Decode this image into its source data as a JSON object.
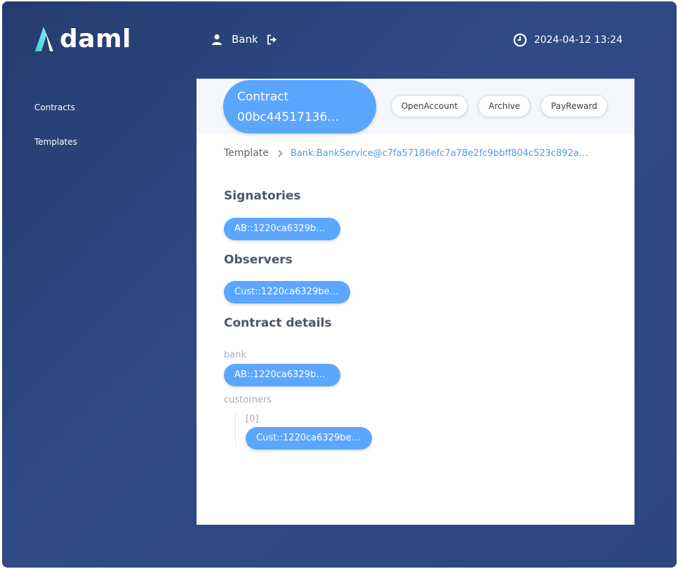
{
  "header": {
    "logo_text": "daml",
    "user_name": "Bank",
    "datetime": "2024-04-12 13:24",
    "icons": {
      "user": "person-icon",
      "logout": "logout-icon",
      "clock": "clock-icon"
    }
  },
  "sidebar": {
    "items": [
      {
        "label": "Contracts"
      },
      {
        "label": "Templates"
      }
    ]
  },
  "contract": {
    "pill_line1": "Contract",
    "pill_line2": "00bc44517136…",
    "choices": [
      "OpenAccount",
      "Archive",
      "PayReward"
    ],
    "breadcrumb": {
      "root": "Template",
      "template_id": "Bank:BankService@c7fa57186efc7a78e2fc9bbff804c523c892a…"
    },
    "signatories_title": "Signatories",
    "signatories": [
      "AB::1220ca6329be…"
    ],
    "observers_title": "Observers",
    "observers": [
      "Cust::1220ca6329be…"
    ],
    "details_title": "Contract details",
    "details": {
      "bank_label": "bank",
      "bank_value": "AB::1220ca6329be…",
      "customers_label": "customers",
      "customers_index": "[0]",
      "customers_value": "Cust::1220ca6329be…"
    }
  },
  "colors": {
    "background": "#2c4680",
    "pill": "#5ba6ff",
    "link": "#4f9ce8",
    "heading": "#4d5669",
    "label": "#a3adbd"
  }
}
